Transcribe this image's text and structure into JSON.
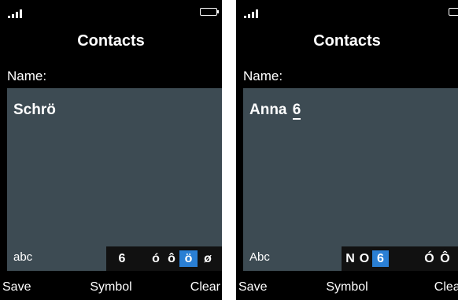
{
  "screens": [
    {
      "title": "Contacts",
      "name_label": "Name:",
      "entry_text": "Schrö",
      "input_mode": "abc",
      "candidates": [
        {
          "char": "6",
          "selected": false
        },
        {
          "char": "ó",
          "selected": false
        },
        {
          "char": "ô",
          "selected": false
        },
        {
          "char": "ö",
          "selected": true
        },
        {
          "char": "ø",
          "selected": false
        }
      ],
      "softkeys": {
        "left": "Save",
        "center": "Symbol",
        "right": "Clear"
      },
      "battery_color": "#1fa64a"
    },
    {
      "title": "Contacts",
      "name_label": "Name:",
      "entry_text": "Anna",
      "entry_pending": "6",
      "input_mode": "Abc",
      "candidates": [
        {
          "char": "N",
          "selected": false
        },
        {
          "char": "O",
          "selected": false
        },
        {
          "char": "6",
          "selected": true
        },
        {
          "char": "Ó",
          "selected": false
        },
        {
          "char": "Ô",
          "selected": false
        }
      ],
      "softkeys": {
        "left": "Save",
        "center": "Symbol",
        "right": "Clear"
      },
      "battery_color": "#1fa64a"
    }
  ],
  "colors": {
    "screen_bg": "#000000",
    "edit_bg": "#3d4b53",
    "selection": "#2a7fd4",
    "candidate_bar": "#111111"
  }
}
